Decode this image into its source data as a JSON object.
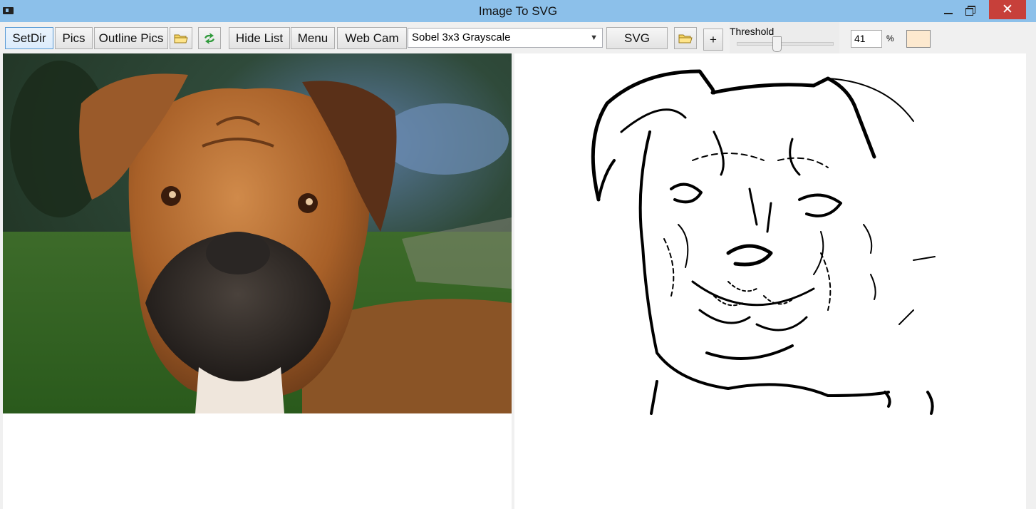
{
  "window": {
    "title": "Image To SVG",
    "close_glyph": "✕"
  },
  "toolbar": {
    "setdir_label": "SetDir",
    "pics_label": "Pics",
    "outline_pics_label": "Outline Pics",
    "hide_list_label": "Hide List",
    "menu_label": "Menu",
    "web_cam_label": "Web Cam",
    "filter_select_value": "Sobel 3x3 Grayscale",
    "svg_label": "SVG",
    "plus_label": "+",
    "threshold_label": "Threshold",
    "threshold_value": "41",
    "threshold_slider_fraction": 0.41,
    "percent_label": "%",
    "color_swatch": "#fde9cf",
    "icons": [
      "folder-icon",
      "refresh-icon",
      "folder-icon",
      "chevron-down-icon"
    ]
  },
  "colors": {
    "titlebar": "#8cc0ea",
    "close": "#c7403a",
    "active_border": "#5a9bd5"
  }
}
